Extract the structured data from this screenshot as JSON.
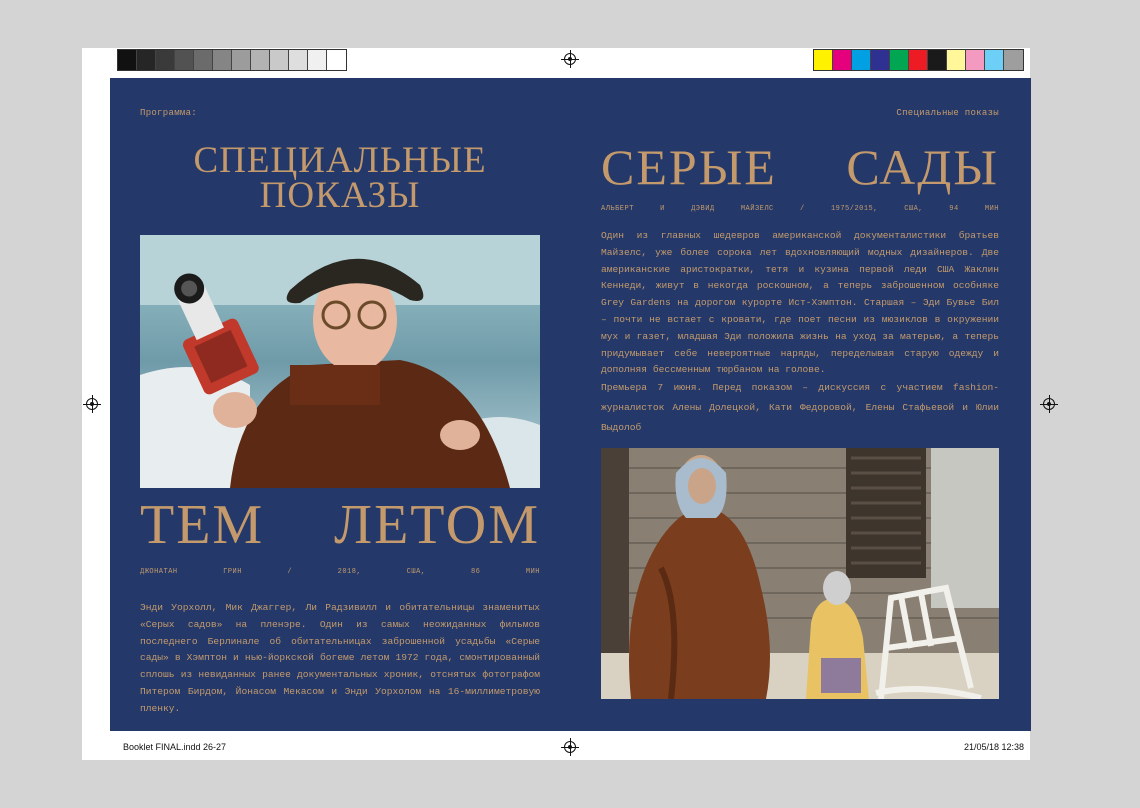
{
  "left_page": {
    "section_label": "Программа:",
    "heading_line1": "СПЕЦИАЛЬНЫЕ",
    "heading_line2": "ПОКАЗЫ",
    "film_title": "ТЕМ ЛЕТОМ",
    "credits": "ДЖОНАТАН ГРИН / 2018, США, 86 МИН",
    "description": "Энди Уорхолл, Мик Джаггер, Ли Радзивилл и обитательницы знаменитых «Серых садов» на пленэре. Один из самых неожиданных фильмов последнего Берлинале об обитательницах заброшенной усадьбы «Серые сады» в Хэмптон и нью-йоркской богеме летом 1972 года, смонтированный сплошь из невиданных ранее документальных хроник, отснятых фотографом Питером Бирдом, Йонасом Мекасом и Энди Уорхолом на 16-миллиметровую пленку."
  },
  "right_page": {
    "section_label": "Специальные показы",
    "film_title": "СЕРЫЕ САДЫ",
    "credits": "АЛЬБЕРТ И ДЭВИД МАЙЗЕЛС / 1975/2015, США, 94 МИН",
    "description": "Один из главных шедевров американской документалистики братьев Майзелс, уже более сорока лет вдохновляющий модных дизайнеров. Две американские аристократки, тетя и кузина первой леди США Жаклин Кеннеди, живут в некогда роскошном, а теперь заброшенном особняке Grey Gardens на дорогом курорте Ист-Хэмптон. Старшая – Эди Бувье Бил – почти не встает с кровати, где поет песни из мюзиклов в окружении мух и газет, младшая Эди положила жизнь на уход за матерью, а теперь придумывает себе невероятные наряды, переделывая старую одежду и дополняя бессменным тюрбаном на голове.",
    "premiere": "Премьера 7 июня. Перед показом – дискуссия с участием fashion-журналисток Алены Долецкой, Кати Федоровой, Елены Стафьевой и Юлии Выдолоб"
  },
  "footer": {
    "file_info": "Booklet FINAL.indd 26-27",
    "date_info": "21/05/18 12:38"
  },
  "colors": {
    "page_background": "#24396a",
    "accent_gold": "#c49a6c",
    "gray_swatches": [
      "#111111",
      "#262626",
      "#3a3a3a",
      "#525252",
      "#6b6b6b",
      "#858585",
      "#9c9c9c",
      "#b3b3b3",
      "#c9c9c9",
      "#dedede",
      "#f0f0f0",
      "#ffffff"
    ],
    "color_swatches": [
      "#fff200",
      "#e5007e",
      "#00a0e2",
      "#2e3192",
      "#00a651",
      "#ed1c24",
      "#1a1a1a",
      "#fff799",
      "#f49ac1",
      "#6dcff6",
      "#9e9e9e"
    ]
  }
}
